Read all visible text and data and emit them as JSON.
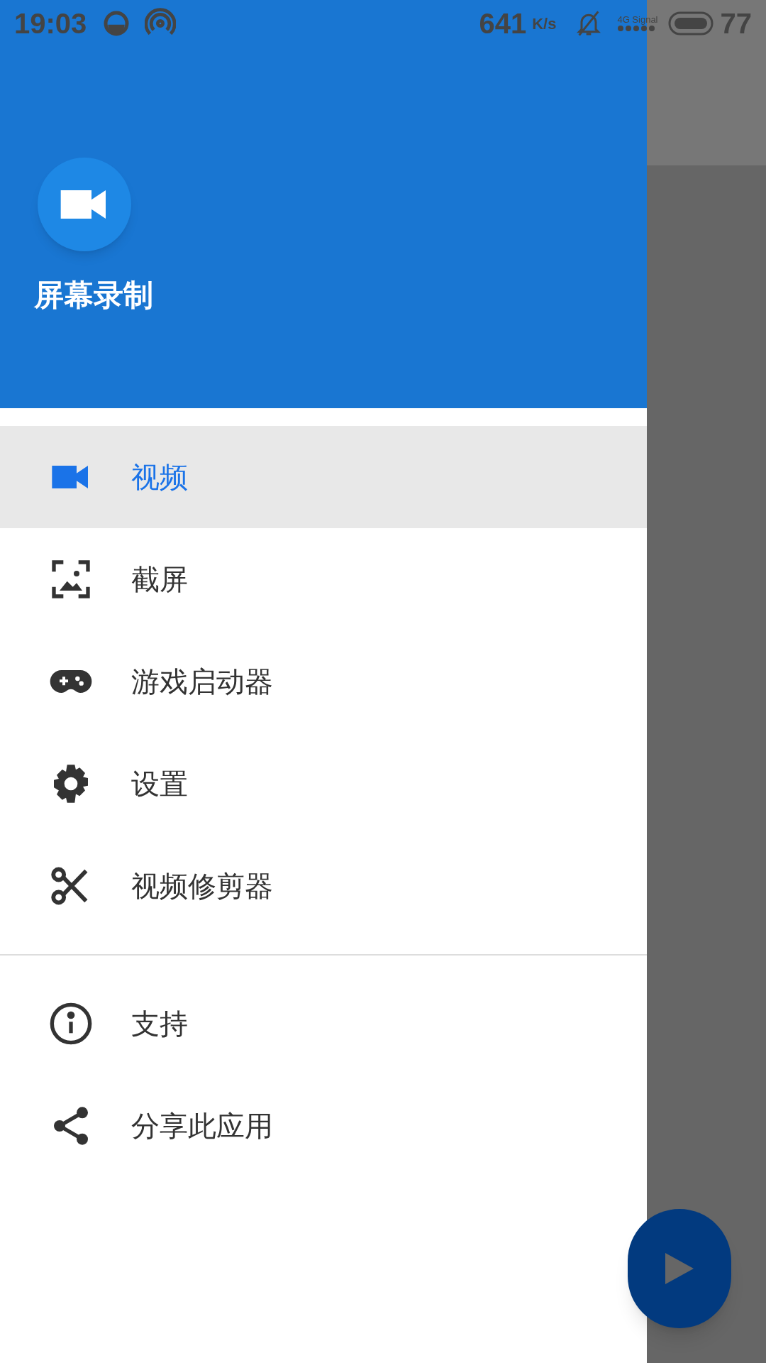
{
  "status_bar": {
    "time": "19:03",
    "speed": "641",
    "speed_unit": "K/s",
    "network": "4G Signal",
    "battery": "77"
  },
  "header": {
    "app_name": "屏幕录制"
  },
  "menu": [
    {
      "kind": "video",
      "label": "视频",
      "selected": true
    },
    {
      "kind": "screenshot",
      "label": "截屏",
      "selected": false
    },
    {
      "kind": "gamepad",
      "label": "游戏启动器",
      "selected": false
    },
    {
      "kind": "settings",
      "label": "设置",
      "selected": false
    },
    {
      "kind": "scissors",
      "label": "视频修剪器",
      "selected": false
    }
  ],
  "secondary_menu": [
    {
      "kind": "info",
      "label": "支持",
      "selected": false
    },
    {
      "kind": "share",
      "label": "分享此应用",
      "selected": false
    }
  ]
}
